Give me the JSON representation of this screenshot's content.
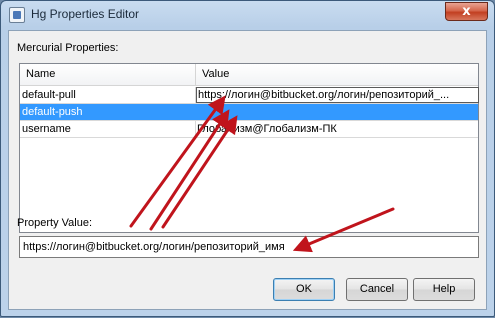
{
  "window": {
    "title": "Hg Properties Editor",
    "close_glyph": "x"
  },
  "section_label": "Mercurial Properties:",
  "table": {
    "columns": [
      "Name",
      "Value"
    ],
    "rows": [
      {
        "name": "default-pull",
        "value": "https://логин@bitbucket.org/логин/репозиторий_..."
      },
      {
        "name": "default-push",
        "value": ""
      },
      {
        "name": "username",
        "value": "Глобализм@Глобализм-ПК"
      }
    ],
    "selected_row": "default-push"
  },
  "property_value": {
    "label": "Property Value:",
    "value": "https://логин@bitbucket.org/логин/репозиторий_имя"
  },
  "buttons": {
    "ok": "OK",
    "cancel": "Cancel",
    "help": "Help"
  },
  "colors": {
    "selection": "#3399ff",
    "arrow": "#c0141c"
  }
}
